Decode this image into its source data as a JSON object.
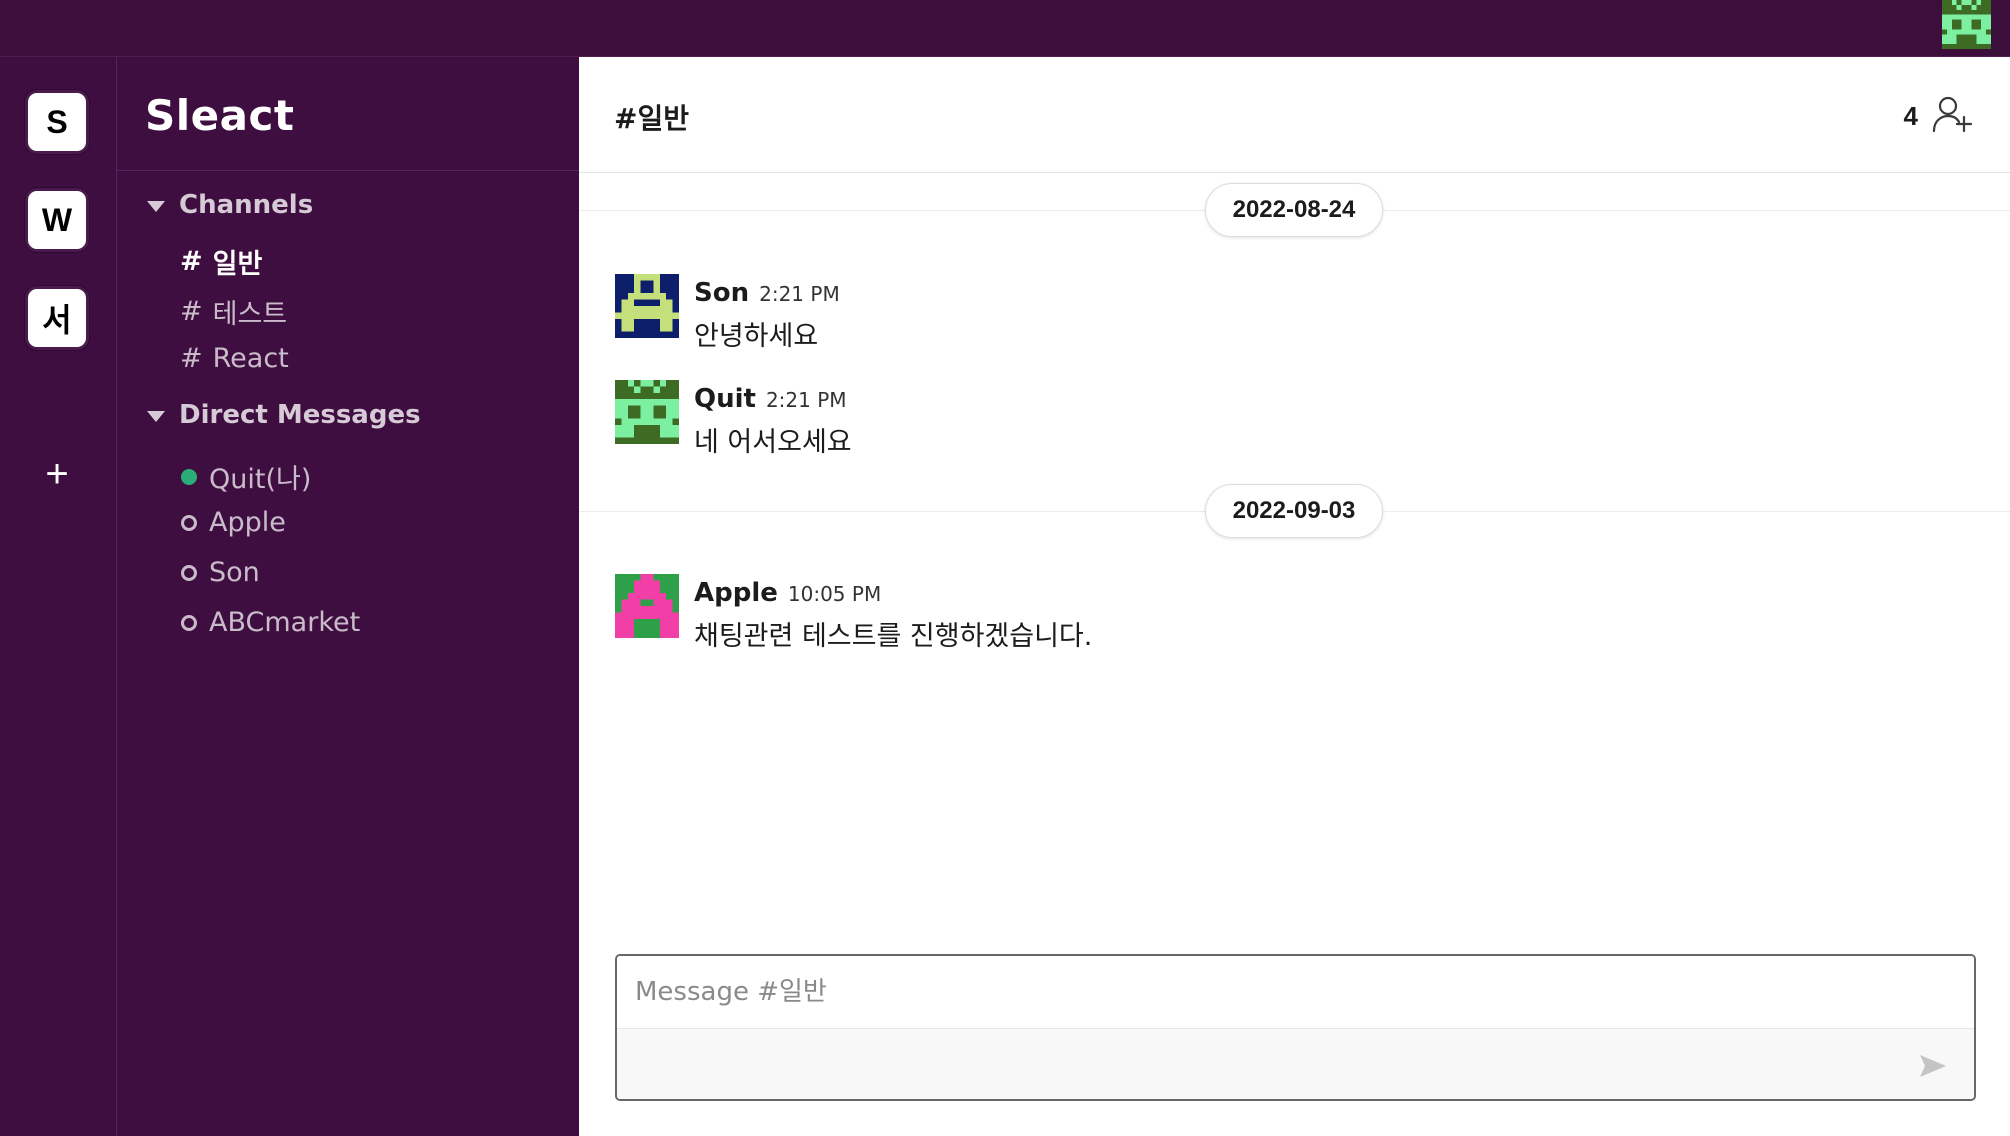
{
  "workspaces": [
    {
      "initial": "S"
    },
    {
      "initial": "W"
    },
    {
      "initial": "서"
    }
  ],
  "workspace_add_label": "+",
  "sidebar": {
    "workspace_name": "Sleact",
    "channels_header": "Channels",
    "channels": [
      {
        "hash": "#",
        "name": "일반",
        "active": true
      },
      {
        "hash": "#",
        "name": "테스트",
        "active": false
      },
      {
        "hash": "#",
        "name": "React",
        "active": false
      }
    ],
    "dm_header": "Direct Messages",
    "dms": [
      {
        "name": "Quit(나)",
        "online": true
      },
      {
        "name": "Apple",
        "online": false
      },
      {
        "name": "Son",
        "online": false
      },
      {
        "name": "ABCmarket",
        "online": false
      }
    ]
  },
  "channel": {
    "title": "#일반",
    "member_count": "4"
  },
  "messages": {
    "groups": [
      {
        "date": "2022-08-24",
        "items": [
          {
            "user": "Son",
            "time": "2:21 PM",
            "text": "안녕하세요"
          },
          {
            "user": "Quit",
            "time": "2:21 PM",
            "text": "네 어서오세요"
          }
        ]
      },
      {
        "date": "2022-09-03",
        "items": [
          {
            "user": "Apple",
            "time": "10:05 PM",
            "text": "채팅관련 테스트를 진행하겠습니다."
          }
        ]
      }
    ]
  },
  "composer": {
    "placeholder": "Message #일반",
    "value": ""
  },
  "colors": {
    "sidebar_bg": "#3f0e40",
    "topbar_bg": "#3b0e3c",
    "online": "#2bac76"
  }
}
